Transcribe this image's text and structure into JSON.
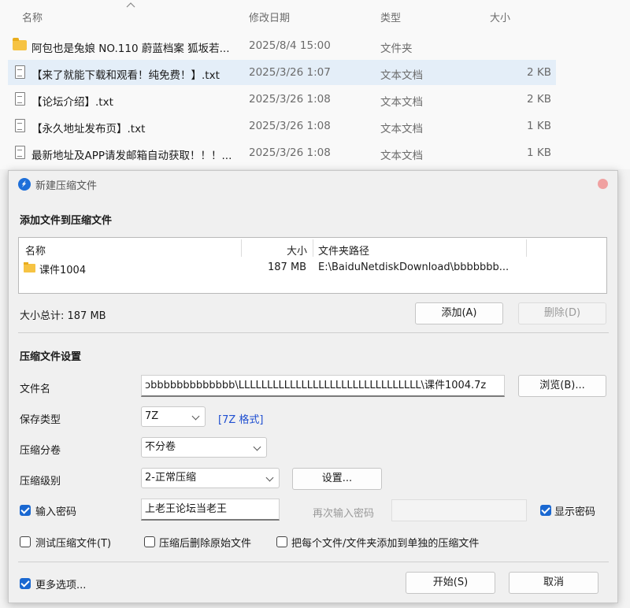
{
  "explorer": {
    "columns": {
      "name": "名称",
      "date": "修改日期",
      "type": "类型",
      "size": "大小"
    },
    "rows": [
      {
        "name": "阿包也是兔娘 NO.110 蔚蓝档案 狐坂若...",
        "date": "2025/8/4 15:00",
        "type": "文件夹",
        "size": "",
        "icon": "folder-icon"
      },
      {
        "name": "【来了就能下载和观看！纯免费！】.txt",
        "date": "2025/3/26 1:07",
        "type": "文本文档",
        "size": "2 KB",
        "icon": "text-file-icon"
      },
      {
        "name": "【论坛介绍】.txt",
        "date": "2025/3/26 1:08",
        "type": "文本文档",
        "size": "2 KB",
        "icon": "text-file-icon"
      },
      {
        "name": "【永久地址发布页】.txt",
        "date": "2025/3/26 1:08",
        "type": "文本文档",
        "size": "1 KB",
        "icon": "text-file-icon"
      },
      {
        "name": "最新地址及APP请发邮箱自动获取！！！...",
        "date": "2025/3/26 1:08",
        "type": "文本文档",
        "size": "1 KB",
        "icon": "text-file-icon"
      }
    ]
  },
  "dialog": {
    "title": "新建压缩文件",
    "add_section_title": "添加文件到压缩文件",
    "list": {
      "col_name": "名称",
      "col_size": "大小",
      "col_path": "文件夹路径",
      "rows": [
        {
          "name": "课件1004",
          "size": "187 MB",
          "path": "E:\\BaiduNetdiskDownload\\bbbbbbb..."
        }
      ]
    },
    "total_size": "大小总计: 187 MB",
    "add_button": "添加(A)",
    "delete_button": "删除(D)",
    "settings_title": "压缩文件设置",
    "filename_label": "文件名",
    "filename_value": "ɔbbbbbbbbbbbbb\\LLLLLLLLLLLLLLLLLLLLLLLLLLLLLLLL\\课件1004.7z",
    "browse_button": "浏览(B)...",
    "save_type_label": "保存类型",
    "save_type_value": "7Z",
    "format_link": "[7Z 格式]",
    "split_label": "压缩分卷",
    "split_value": "不分卷",
    "level_label": "压缩级别",
    "level_value": "2-正常压缩",
    "settings_button": "设置...",
    "password_label": "输入密码",
    "password_value": "上老王论坛当老王",
    "password_repeat_placeholder": "再次输入密码",
    "show_password_label": "显示密码",
    "test_label": "测试压缩文件(T)",
    "delete_after_label": "压缩后删除原始文件",
    "each_separate_label": "把每个文件/文件夹添加到单独的压缩文件",
    "more_options_label": "更多选项...",
    "start_button": "开始(S)",
    "cancel_button": "取消"
  }
}
